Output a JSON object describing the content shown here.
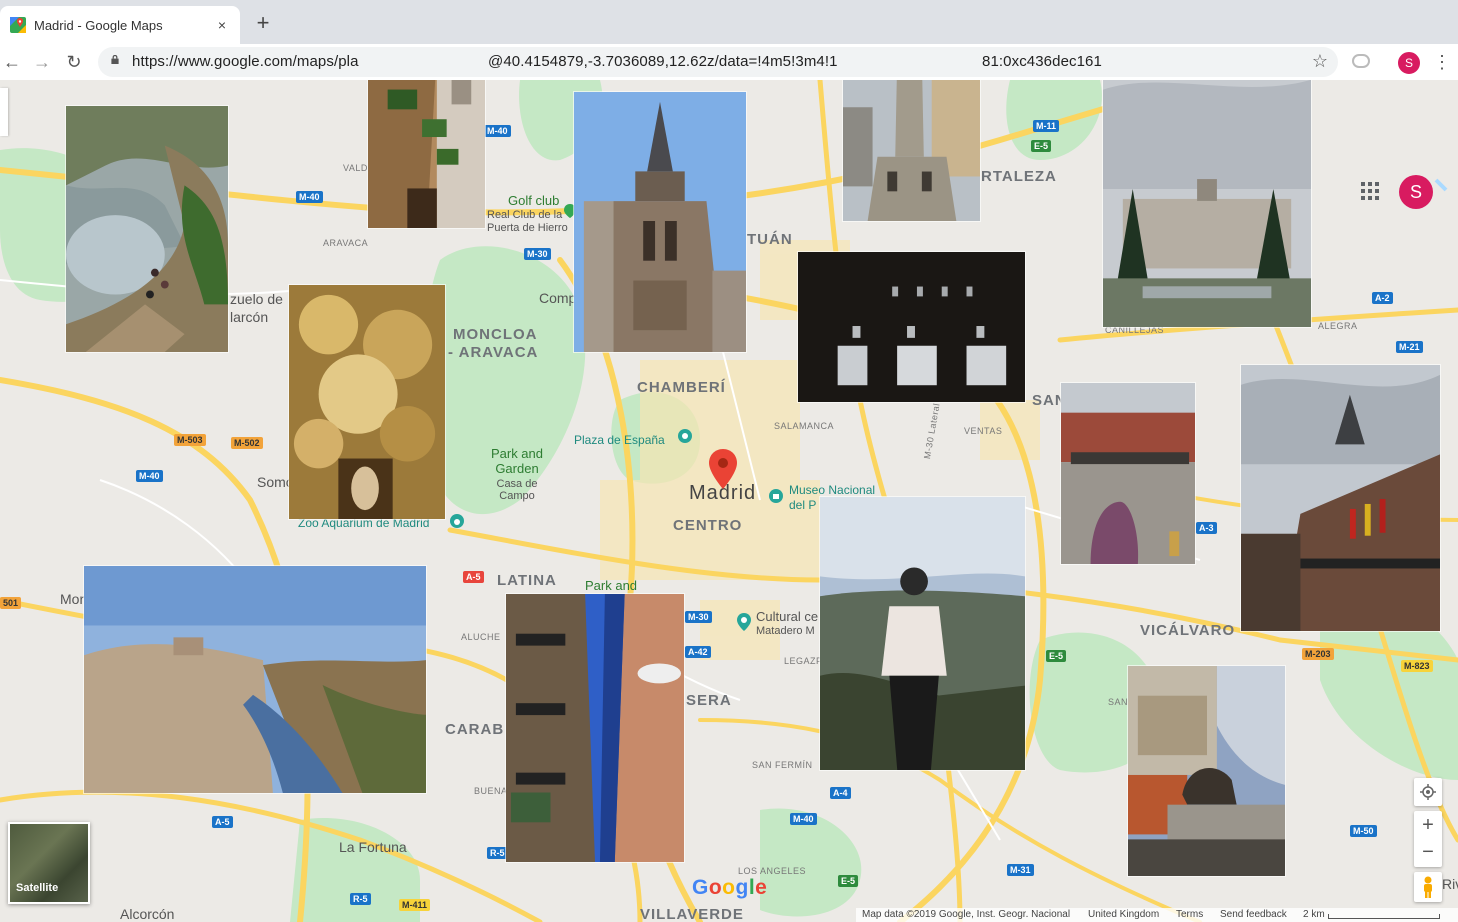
{
  "browser": {
    "tab_title": "Madrid - Google Maps",
    "tab_close": "×",
    "new_tab": "+",
    "back": "←",
    "forward": "→",
    "reload": "↻",
    "url_left": "https://www.google.com/maps/pla",
    "url_mid": "@40.4154879,-3.7036089,12.62z/data=!4m5!3m4!1",
    "url_right": "81:0xc436dec161",
    "bookmark": "☆",
    "profile_initial": "S",
    "menu": "⋮"
  },
  "map": {
    "labels": {
      "moncloa1": "MONCLOA",
      "moncloa2": "- ARAVACA",
      "chamberi": "CHAMBERÍ",
      "centro": "CENTRO",
      "latina": "LATINA",
      "vicalvaro": "VICÁLVARO",
      "hortaleza": "RTALEZA",
      "tuan": "TUÁN",
      "sera": "SERA",
      "caraba": "CARAB",
      "san": "SAN",
      "madrid": "Madrid",
      "golf1": "Golf club",
      "golf2": "Real Club de la",
      "golf3": "Puerta de Hierro",
      "comp": "Comp",
      "park_garden": "Park and Garden",
      "casa_campo": "Casa de Campo",
      "plaza_espana": "Plaza de España",
      "museo1": "Museo Nacional",
      "museo2": "del P",
      "zoo": "Zoo Aquarium de Madrid",
      "park_and": "Park and",
      "cultural1": "Cultural ce",
      "cultural2": "Matadero M",
      "pozuelo1": "zuelo de",
      "pozuelo2": "larcón",
      "somo": "Somo",
      "mor": "Mor",
      "la_fortuna": "La Fortuna",
      "alcorcon": "Alcorcón",
      "villaverde": "VILLAVERDE",
      "valde": "VALD",
      "aravaca": "ARAVACA",
      "salamanca": "SALAMANCA",
      "ventas": "VENTAS",
      "legazpi": "LEGAZPI",
      "san_fermin": "SAN FERMÍN",
      "los_angeles": "LOS ANGELES",
      "aluche": "ALUCHE",
      "buena": "BUENA",
      "canillejas": "CANILLEJAS",
      "alegra": "ALEGRA",
      "san2": "SAN",
      "riva": "Riv",
      "m30_lateral": "M-30 Lateral"
    },
    "shields": {
      "m40a": "M-40",
      "m40b": "M-40",
      "m40c": "M-40",
      "m40d": "M-40",
      "m40e": "M-40",
      "m30a": "M-30",
      "m30b": "M-30",
      "m11": "M-11",
      "e5a": "E-5",
      "e5b": "E-5",
      "e5c": "E-5",
      "a2": "A-2",
      "m21": "M-21",
      "a3": "A-3",
      "m503": "M-503",
      "m502": "M-502",
      "m501": "501",
      "a5a": "A-5",
      "a5b": "A-5",
      "a42": "A-42",
      "m203": "M-203",
      "m823": "M-823",
      "a4": "A-4",
      "r5a": "R-5",
      "r5b": "R-5",
      "m411": "M-411",
      "m31": "M-31",
      "m50": "M-50"
    },
    "controls": {
      "zoom_in": "+",
      "zoom_out": "−",
      "satellite_label": "Satellite",
      "profile_initial": "S"
    },
    "footer": {
      "map_data": "Map data ©2019 Google, Inst. Geogr. Nacional",
      "region": "United Kingdom",
      "terms": "Terms",
      "feedback": "Send feedback",
      "scale": "2 km"
    },
    "google_logo": [
      "G",
      "o",
      "o",
      "g",
      "l",
      "e"
    ],
    "google_colors": [
      "#4285F4",
      "#EA4335",
      "#FBBC05",
      "#4285F4",
      "#34A853",
      "#EA4335"
    ],
    "road_color": "#fbd560",
    "park_color": "#c5e8c5",
    "water_color": "#aadaff",
    "pin_color": "#ea4335"
  },
  "photos": [
    {
      "name": "gorge-hikers-photo"
    },
    {
      "name": "balcony-plants-photo"
    },
    {
      "name": "cathedral-tower-photo"
    },
    {
      "name": "cervantes-monument-photo"
    },
    {
      "name": "royal-palace-photo"
    },
    {
      "name": "golden-altarpiece-photo"
    },
    {
      "name": "dark-windows-photo"
    },
    {
      "name": "plaza-mayor-photo"
    },
    {
      "name": "town-hall-flags-photo"
    },
    {
      "name": "toledo-panorama-photo"
    },
    {
      "name": "narrow-street-photo"
    },
    {
      "name": "person-overlook-photo"
    },
    {
      "name": "lion-statue-photo"
    }
  ]
}
